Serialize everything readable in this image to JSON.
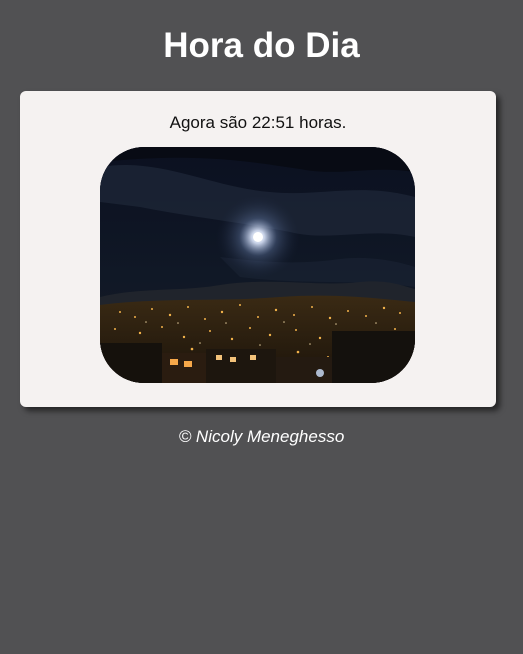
{
  "header": {
    "title": "Hora do Dia"
  },
  "main": {
    "time_message": "Agora são 22:51 horas.",
    "image_icon": "night-city-photo"
  },
  "footer": {
    "credit": "© Nicoly Meneghesso"
  },
  "colors": {
    "background": "#515153",
    "card": "#f5f2f1",
    "title_text": "#ffffff",
    "body_text": "#111111"
  }
}
